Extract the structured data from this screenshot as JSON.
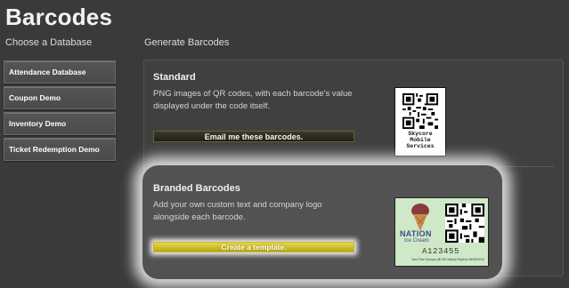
{
  "page": {
    "title": "Barcodes"
  },
  "left": {
    "heading": "Choose a Database",
    "databases": [
      {
        "label": "Attendance Database"
      },
      {
        "label": "Coupon Demo"
      },
      {
        "label": "Inventory Demo"
      },
      {
        "label": "Ticket Redemption Demo"
      }
    ]
  },
  "right": {
    "heading": "Generate Barcodes",
    "standard": {
      "title": "Standard",
      "description": "PNG images of QR codes, with each barcode's value displayed under the code itself.",
      "button_label": "Email me these barcodes.",
      "sample_caption_line1": "Skycore",
      "sample_caption_line2": "Mobile",
      "sample_caption_line3": "Services"
    },
    "branded": {
      "title": "Branded Barcodes",
      "description": "Add your own custom text and company logo alongside each barcode.",
      "button_label": "Create a template.",
      "sample_brand": "NATION",
      "sample_brand_sub": "Ice Cream",
      "sample_code": "A123455",
      "sample_fine_print": "Two Free Scoops ($1.50 Value) Expires 06/30/2011"
    }
  },
  "colors": {
    "background": "#3a3a3a",
    "create_button": "#d4c42a",
    "brand_card": "#cfe8c8"
  }
}
